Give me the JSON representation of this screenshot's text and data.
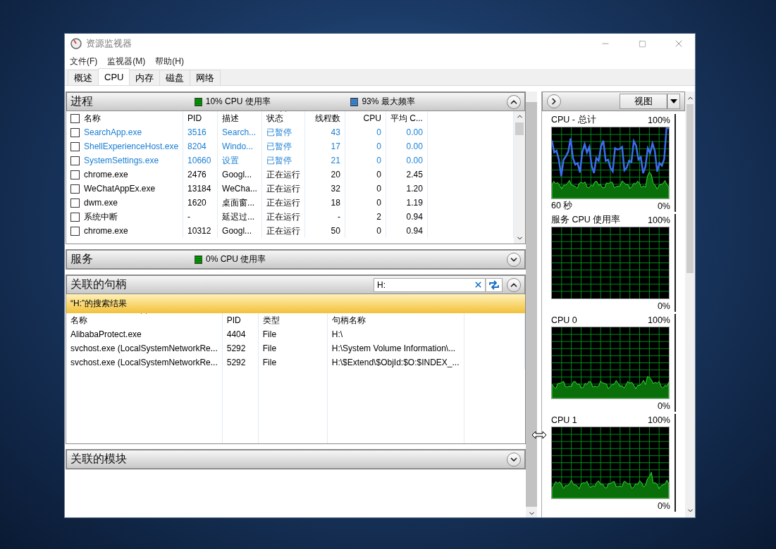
{
  "window": {
    "title": "资源监视器"
  },
  "menu": [
    "文件(F)",
    "监视器(M)",
    "帮助(H)"
  ],
  "tabs": [
    {
      "label": "概述",
      "selected": false
    },
    {
      "label": "CPU",
      "selected": true
    },
    {
      "label": "内存",
      "selected": false
    },
    {
      "label": "磁盘",
      "selected": false
    },
    {
      "label": "网络",
      "selected": false
    }
  ],
  "processes": {
    "title": "进程",
    "expanded": true,
    "indicators": [
      {
        "label": "10% CPU 使用率",
        "color": "#00a000"
      },
      {
        "label": "93% 最大频率",
        "color": "#3d8fe0"
      }
    ],
    "select_all_checked": false,
    "columns": [
      {
        "label": "名称",
        "sorted": false
      },
      {
        "label": "PID",
        "sorted": false
      },
      {
        "label": "描述",
        "sorted": false
      },
      {
        "label": "状态",
        "sorted": true
      },
      {
        "label": "线程数",
        "sorted": false
      },
      {
        "label": "CPU",
        "sorted": false
      },
      {
        "label": "平均 C...",
        "sorted": false
      }
    ],
    "rows": [
      {
        "checked": false,
        "suspended": true,
        "cells": [
          "SearchApp.exe",
          "3516",
          "Search...",
          "已暂停",
          "43",
          "0",
          "0.00"
        ]
      },
      {
        "checked": false,
        "suspended": true,
        "cells": [
          "ShellExperienceHost.exe",
          "8204",
          "Windo...",
          "已暂停",
          "17",
          "0",
          "0.00"
        ]
      },
      {
        "checked": false,
        "suspended": true,
        "cells": [
          "SystemSettings.exe",
          "10660",
          "设置",
          "已暂停",
          "21",
          "0",
          "0.00"
        ]
      },
      {
        "checked": false,
        "suspended": false,
        "cells": [
          "chrome.exe",
          "2476",
          "Googl...",
          "正在运行",
          "20",
          "0",
          "2.45"
        ]
      },
      {
        "checked": false,
        "suspended": false,
        "cells": [
          "WeChatAppEx.exe",
          "13184",
          "WeCha...",
          "正在运行",
          "32",
          "0",
          "1.20"
        ]
      },
      {
        "checked": false,
        "suspended": false,
        "cells": [
          "dwm.exe",
          "1620",
          "桌面窗...",
          "正在运行",
          "18",
          "0",
          "1.19"
        ]
      },
      {
        "checked": false,
        "suspended": false,
        "cells": [
          "系统中断",
          "-",
          "延迟过...",
          "正在运行",
          "-",
          "2",
          "0.94"
        ]
      },
      {
        "checked": false,
        "suspended": false,
        "cells": [
          "chrome.exe",
          "10312",
          "Googl...",
          "正在运行",
          "50",
          "0",
          "0.94"
        ]
      }
    ]
  },
  "services": {
    "title": "服务",
    "expanded": false,
    "indicators": [
      {
        "label": "0% CPU 使用率",
        "color": "#00a000"
      }
    ]
  },
  "handles": {
    "title": "关联的句柄",
    "expanded": true,
    "search": {
      "value": "H:"
    },
    "result_banner": "“H:”的搜索结果",
    "columns": [
      {
        "label": "名称",
        "sorted": true
      },
      {
        "label": "PID",
        "sorted": false
      },
      {
        "label": "类型",
        "sorted": false
      },
      {
        "label": "句柄名称",
        "sorted": false
      }
    ],
    "rows": [
      [
        "AlibabaProtect.exe",
        "4404",
        "File",
        "H:\\"
      ],
      [
        "svchost.exe (LocalSystemNetworkRe...",
        "5292",
        "File",
        "H:\\System Volume Information\\..."
      ],
      [
        "svchost.exe (LocalSystemNetworkRe...",
        "5292",
        "File",
        "H:\\$Extend\\$ObjId:$O:$INDEX_..."
      ]
    ]
  },
  "modules": {
    "title": "关联的模块",
    "expanded": false
  },
  "graphs_panel": {
    "view_button": "视图",
    "graphs": [
      {
        "kind": "total",
        "title": "CPU - 总计",
        "top_label": "100%",
        "bottom_left": "60 秒",
        "bottom_label": "0%"
      },
      {
        "kind": "service",
        "title": "服务 CPU 使用率",
        "top_label": "100%",
        "bottom_label": "0%"
      },
      {
        "kind": "core",
        "title": "CPU 0",
        "top_label": "100%",
        "bottom_label": "0%"
      },
      {
        "kind": "core",
        "title": "CPU 1",
        "top_label": "100%",
        "bottom_label": "0%"
      }
    ]
  }
}
